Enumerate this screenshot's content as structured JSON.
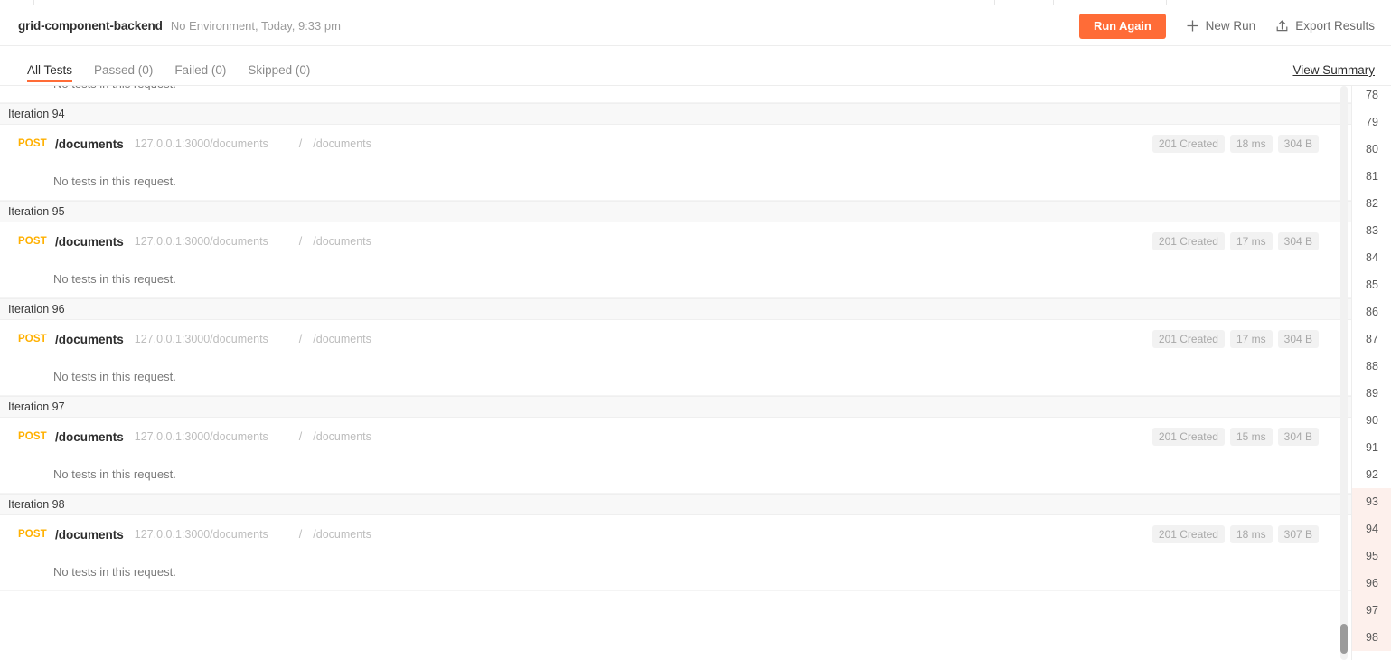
{
  "window": {
    "tab_divider_positions": [
      37,
      1100,
      1165,
      1290
    ]
  },
  "header": {
    "run_name": "grid-component-backend",
    "run_meta": "No Environment, Today, 9:33 pm",
    "run_again_label": "Run Again",
    "new_run_label": "New Run",
    "new_run_icon": "plus-icon",
    "export_results_label": "Export Results",
    "export_results_icon": "upload-share-icon"
  },
  "tabs": {
    "items": [
      {
        "label": "All Tests",
        "active": true
      },
      {
        "label": "Passed (0)",
        "active": false
      },
      {
        "label": "Failed (0)",
        "active": false
      },
      {
        "label": "Skipped (0)",
        "active": false
      }
    ],
    "view_summary_label": "View Summary"
  },
  "results": {
    "clipped_top_tests_text": "No tests in this request.",
    "iterations": [
      {
        "title": "Iteration 94",
        "method": "POST",
        "request_name": "/documents",
        "url": "127.0.0.1:3000/documents",
        "path_separator": "/",
        "path": "/documents",
        "status": "201 Created",
        "time": "18 ms",
        "size": "304 B",
        "tests_text": "No tests in this request."
      },
      {
        "title": "Iteration 95",
        "method": "POST",
        "request_name": "/documents",
        "url": "127.0.0.1:3000/documents",
        "path_separator": "/",
        "path": "/documents",
        "status": "201 Created",
        "time": "17 ms",
        "size": "304 B",
        "tests_text": "No tests in this request."
      },
      {
        "title": "Iteration 96",
        "method": "POST",
        "request_name": "/documents",
        "url": "127.0.0.1:3000/documents",
        "path_separator": "/",
        "path": "/documents",
        "status": "201 Created",
        "time": "17 ms",
        "size": "304 B",
        "tests_text": "No tests in this request."
      },
      {
        "title": "Iteration 97",
        "method": "POST",
        "request_name": "/documents",
        "url": "127.0.0.1:3000/documents",
        "path_separator": "/",
        "path": "/documents",
        "status": "201 Created",
        "time": "15 ms",
        "size": "304 B",
        "tests_text": "No tests in this request."
      },
      {
        "title": "Iteration 98",
        "method": "POST",
        "request_name": "/documents",
        "url": "127.0.0.1:3000/documents",
        "path_separator": "/",
        "path": "/documents",
        "status": "201 Created",
        "time": "18 ms",
        "size": "307 B",
        "tests_text": "No tests in this request."
      }
    ]
  },
  "iteration_rail": {
    "items": [
      {
        "label": "78",
        "highlight": false
      },
      {
        "label": "79",
        "highlight": false
      },
      {
        "label": "80",
        "highlight": false
      },
      {
        "label": "81",
        "highlight": false
      },
      {
        "label": "82",
        "highlight": false
      },
      {
        "label": "83",
        "highlight": false
      },
      {
        "label": "84",
        "highlight": false
      },
      {
        "label": "85",
        "highlight": false
      },
      {
        "label": "86",
        "highlight": false
      },
      {
        "label": "87",
        "highlight": false
      },
      {
        "label": "88",
        "highlight": false
      },
      {
        "label": "89",
        "highlight": false
      },
      {
        "label": "90",
        "highlight": false
      },
      {
        "label": "91",
        "highlight": false
      },
      {
        "label": "92",
        "highlight": false
      },
      {
        "label": "93",
        "highlight": true
      },
      {
        "label": "94",
        "highlight": true
      },
      {
        "label": "95",
        "highlight": true
      },
      {
        "label": "96",
        "highlight": true
      },
      {
        "label": "97",
        "highlight": true
      },
      {
        "label": "98",
        "highlight": true
      }
    ]
  },
  "colors": {
    "accent": "#ff6c37",
    "method_post": "#ffb000",
    "highlight_row": "#fdf0ec",
    "band": "#f8f8f8"
  }
}
